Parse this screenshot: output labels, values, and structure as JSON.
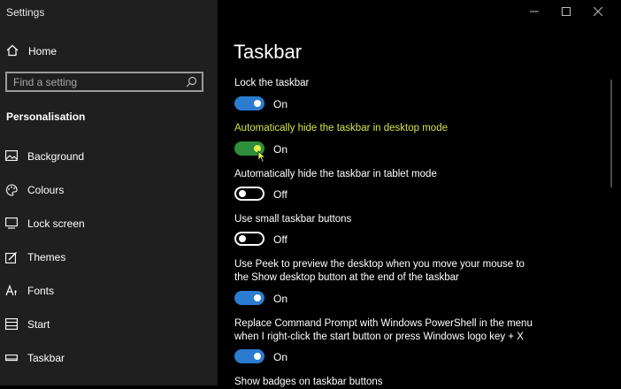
{
  "window": {
    "title": "Settings"
  },
  "sidebar": {
    "home_label": "Home",
    "search_placeholder": "Find a setting",
    "section_title": "Personalisation",
    "items": [
      {
        "label": "Background",
        "icon": "image-icon"
      },
      {
        "label": "Colours",
        "icon": "palette-icon"
      },
      {
        "label": "Lock screen",
        "icon": "lock-screen-icon"
      },
      {
        "label": "Themes",
        "icon": "themes-icon"
      },
      {
        "label": "Fonts",
        "icon": "fonts-icon"
      },
      {
        "label": "Start",
        "icon": "start-icon"
      },
      {
        "label": "Taskbar",
        "icon": "taskbar-icon"
      }
    ]
  },
  "main": {
    "title": "Taskbar",
    "settings": [
      {
        "label": "Lock the taskbar",
        "state": "On"
      },
      {
        "label": "Automatically hide the taskbar in desktop mode",
        "state": "On"
      },
      {
        "label": "Automatically hide the taskbar in tablet mode",
        "state": "Off"
      },
      {
        "label": "Use small taskbar buttons",
        "state": "Off"
      },
      {
        "label": "Use Peek to preview the desktop when you move your mouse to the Show desktop button at the end of the taskbar",
        "state": "On"
      },
      {
        "label": "Replace Command Prompt with Windows PowerShell in the menu when I right-click the start button or press Windows logo key + X",
        "state": "On"
      },
      {
        "label": "Show badges on taskbar buttons"
      }
    ]
  },
  "colors": {
    "accent": "#2b7bd0",
    "highlight": "#d7e24a",
    "sidebar_bg": "#1f1f1f"
  }
}
